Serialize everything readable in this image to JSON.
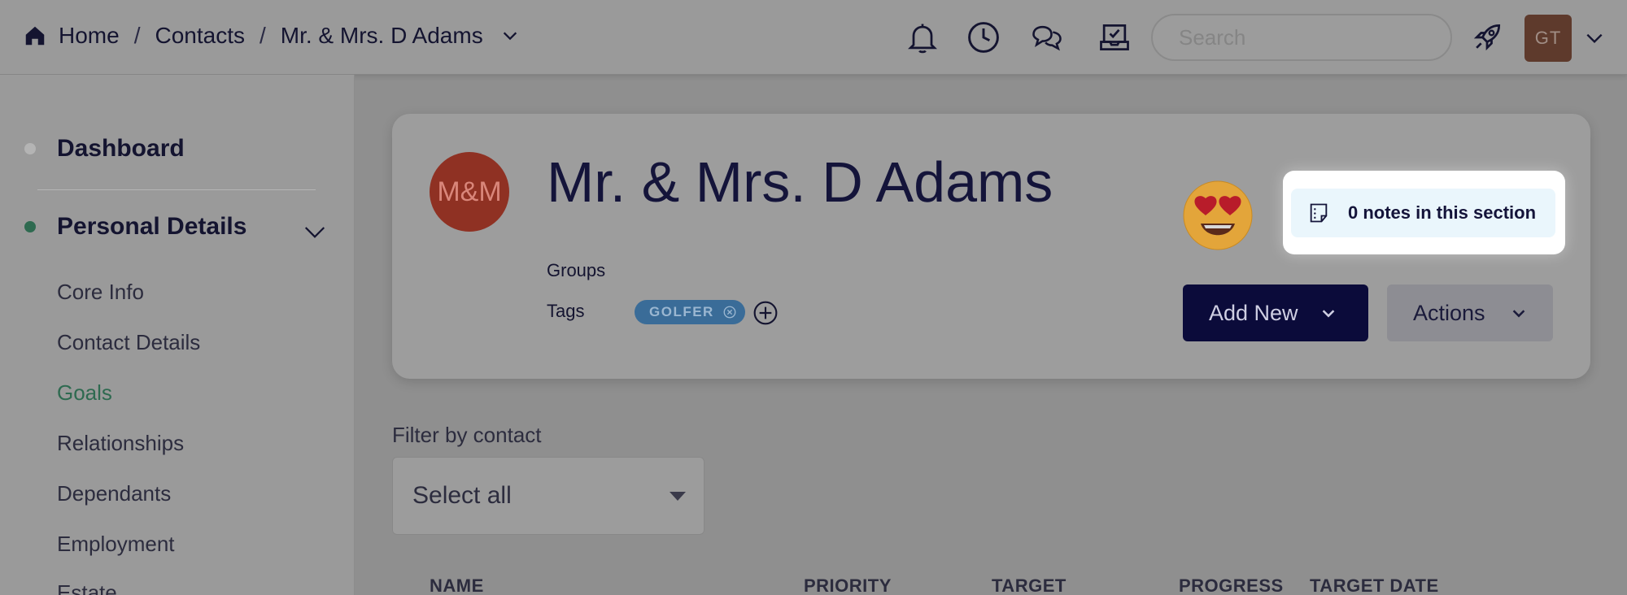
{
  "breadcrumb": {
    "home": "Home",
    "contacts": "Contacts",
    "current": "Mr. & Mrs. D Adams",
    "separator": "/"
  },
  "header": {
    "search_placeholder": "Search",
    "user_initials": "GT",
    "icons": [
      "bell-icon",
      "clock-icon",
      "chat-icon",
      "tasks-icon",
      "rocket-icon"
    ]
  },
  "sidebar": {
    "dashboard": "Dashboard",
    "section": "Personal Details",
    "items": [
      "Core Info",
      "Contact Details",
      "Goals",
      "Relationships",
      "Dependants",
      "Employment",
      "Estate"
    ],
    "active_item": "Goals"
  },
  "contact": {
    "initials": "M&M",
    "name": "Mr. & Mrs. D Adams",
    "groups_label": "Groups",
    "tags_label": "Tags",
    "tags": [
      "GOLFER"
    ]
  },
  "notes": {
    "label": "0 notes in this section"
  },
  "actions": {
    "add_new": "Add New",
    "actions": "Actions"
  },
  "filter": {
    "label": "Filter by contact",
    "selected": "Select all"
  },
  "table": {
    "columns": [
      "NAME",
      "PRIORITY",
      "TARGET",
      "PROGRESS",
      "TARGET DATE"
    ]
  },
  "colors": {
    "navy": "#0b0b3a",
    "tag_blue": "#3a6c98",
    "avatar_red": "#8f3123",
    "active_green": "#2e6a50",
    "notes_bg": "#eaf6fc"
  }
}
